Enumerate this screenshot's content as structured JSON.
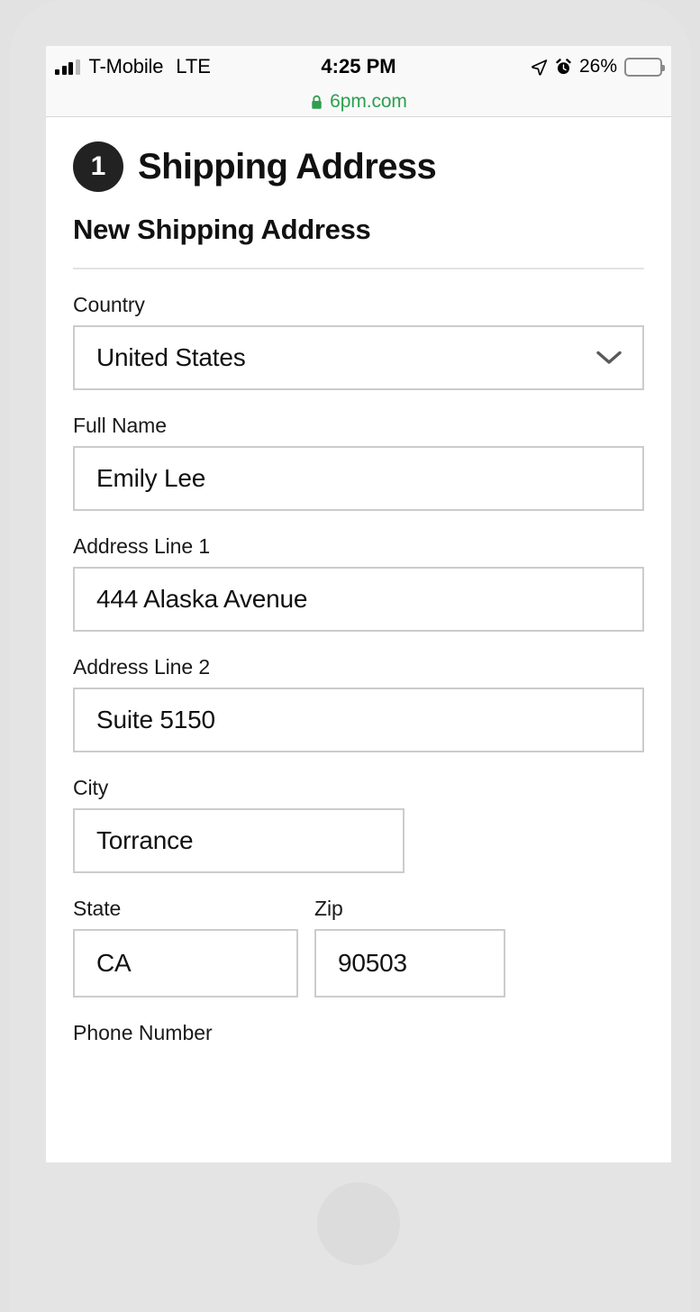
{
  "status_bar": {
    "carrier": "T-Mobile",
    "network": "LTE",
    "time": "4:25 PM",
    "battery_percent": "26%",
    "battery_level": 26,
    "battery_color": "#ffc805",
    "signal_bars_filled": 3,
    "signal_bars_total": 4,
    "location_icon": "location-arrow-icon",
    "alarm_icon": "alarm-clock-icon"
  },
  "browser": {
    "lock_icon": "lock-icon",
    "url": "6pm.com",
    "url_color": "#2e9e4f"
  },
  "checkout": {
    "step_number": "1",
    "step_title": "Shipping Address",
    "section_title": "New Shipping Address",
    "badge_color": "#222222"
  },
  "form": {
    "country": {
      "label": "Country",
      "value": "United States",
      "type": "select",
      "chevron_icon": "chevron-down-icon"
    },
    "full_name": {
      "label": "Full Name",
      "value": "Emily Lee",
      "type": "text"
    },
    "address_line_1": {
      "label": "Address Line 1",
      "value": "444 Alaska Avenue",
      "type": "text"
    },
    "address_line_2": {
      "label": "Address Line 2",
      "value": "Suite 5150",
      "type": "text"
    },
    "city": {
      "label": "City",
      "value": "Torrance",
      "type": "text"
    },
    "state": {
      "label": "State",
      "value": "CA",
      "type": "text"
    },
    "zip": {
      "label": "Zip",
      "value": "90503",
      "type": "text"
    },
    "phone_number": {
      "label": "Phone Number",
      "value": "",
      "type": "text"
    }
  }
}
